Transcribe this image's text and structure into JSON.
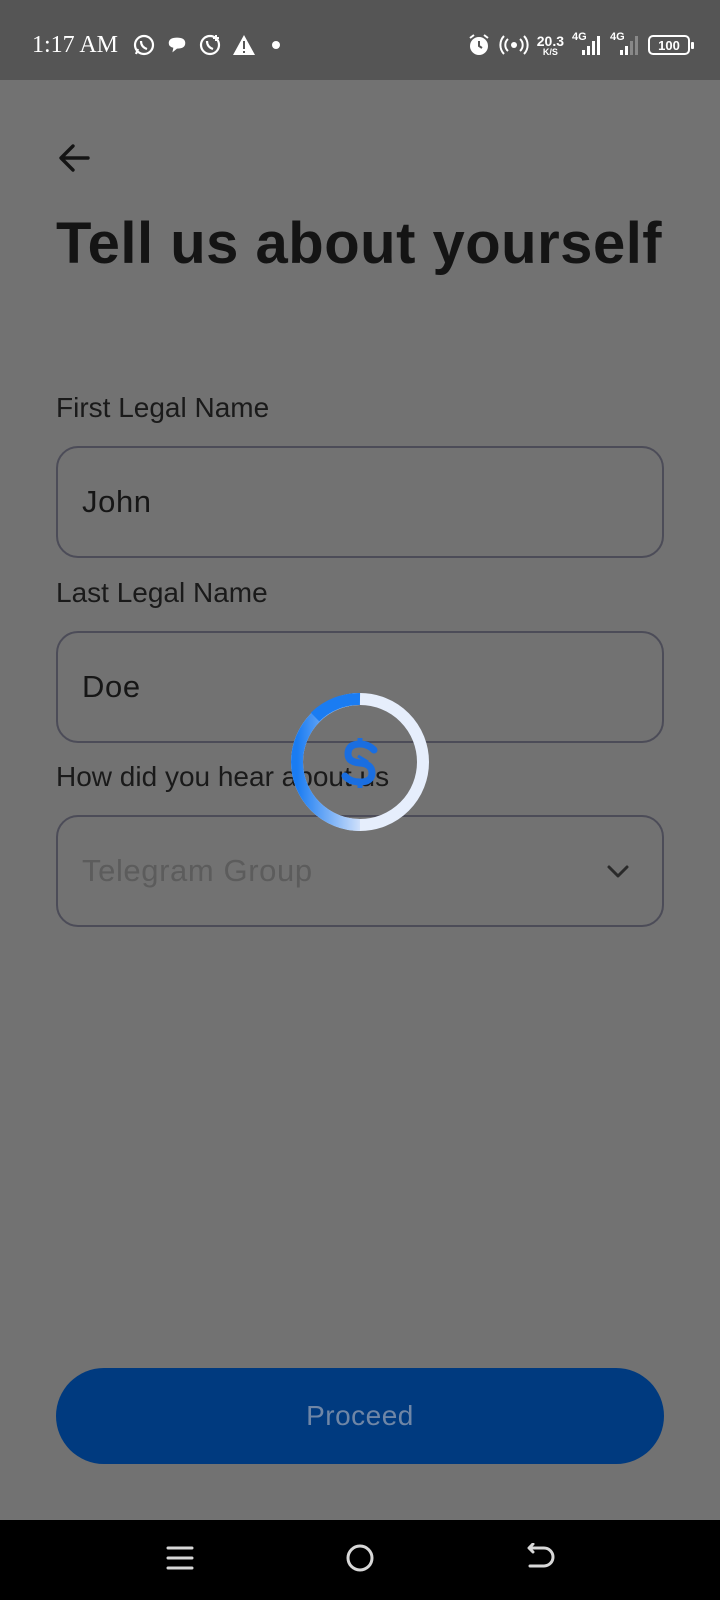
{
  "status_bar": {
    "time": "1:17 AM",
    "net_speed_value": "20.3",
    "net_speed_unit": "K/S",
    "sim1": "4G",
    "sim2": "4G",
    "battery": "100",
    "left_icons": [
      "whatsapp-icon",
      "chat-bubble-icon",
      "whatsapp-business-icon",
      "warning-icon",
      "dot-icon"
    ],
    "right_icons": [
      "alarm-icon",
      "hotspot-icon",
      "signal-icon",
      "signal-icon",
      "battery-icon"
    ]
  },
  "page": {
    "title": "Tell us about yourself",
    "back_icon": "arrow-left-icon"
  },
  "form": {
    "first_name": {
      "label": "First Legal Name",
      "value": "John"
    },
    "last_name": {
      "label": "Last Legal Name",
      "value": "Doe"
    },
    "referral": {
      "label": "How did you hear about us",
      "placeholder": "Telegram Group",
      "icon": "chevron-down-icon"
    }
  },
  "proceed_label": "Proceed",
  "loading": {
    "icon": "dollar-logo-icon",
    "active": true
  },
  "nav_bar": {
    "icons": [
      "menu-icon",
      "home-icon",
      "back-icon"
    ]
  },
  "colors": {
    "overlay_background": "#727272",
    "status_bar": "#555555",
    "button": "#003a7f",
    "spinner_accent": "#1a7cf2",
    "spinner_track": "#e6eefc"
  }
}
